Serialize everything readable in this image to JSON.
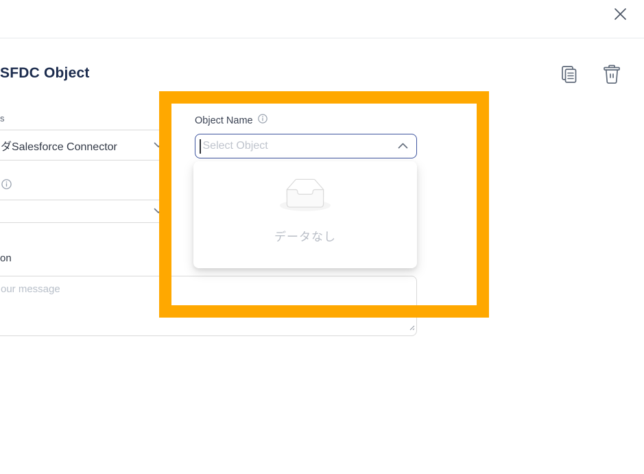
{
  "colors": {
    "highlight_orange": "#FFA800",
    "focus_border_blue": "#3E559F",
    "title_navy": "#1B2B4D",
    "icon_gray": "#5D6878",
    "border_gray": "#D9D9D9",
    "placeholder_gray": "#BFC4CD"
  },
  "titlebar": {
    "close_icon": "close"
  },
  "header": {
    "title": "SFDC Object",
    "copy_icon": "copy-documents",
    "delete_icon": "trash-can"
  },
  "form_left": {
    "top_label_fragment": "s",
    "connector_select": {
      "value": "ダSalesforce Connector",
      "chevron_icon": "chevron-down"
    },
    "info_icon": "info-circle",
    "secondary_select": {
      "value": "",
      "chevron_icon": "chevron-down"
    },
    "description_label_fragment": "on",
    "message_textarea": {
      "placeholder_fragment": "our message",
      "resize_icon": "resize-grip"
    }
  },
  "highlight_box": {
    "type": "tutorial-highlight-frame"
  },
  "object_name_field": {
    "label": "Object Name",
    "info_icon": "info-circle",
    "select": {
      "placeholder": "Select Object",
      "chevron_icon": "chevron-up",
      "state": "open-focused"
    },
    "dropdown": {
      "empty_icon": "empty-inbox",
      "empty_text": "データなし"
    }
  }
}
